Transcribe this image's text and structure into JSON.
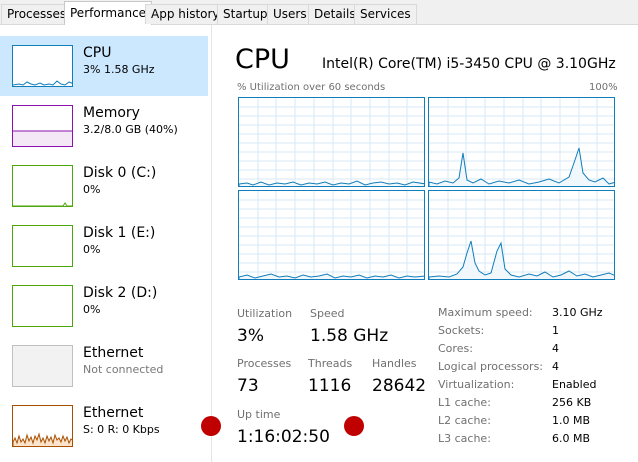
{
  "tabs": [
    {
      "label": "Processes",
      "active": false
    },
    {
      "label": "Performance",
      "active": true
    },
    {
      "label": "App history",
      "active": false
    },
    {
      "label": "Startup",
      "active": false
    },
    {
      "label": "Users",
      "active": false
    },
    {
      "label": "Details",
      "active": false
    },
    {
      "label": "Services",
      "active": false
    }
  ],
  "sidebar": {
    "items": [
      {
        "title": "CPU",
        "subtitle": "3% 1.58 GHz",
        "color": "#117dbb",
        "selected": true
      },
      {
        "title": "Memory",
        "subtitle": "3.2/8.0 GB (40%)",
        "color": "#8b12ae",
        "selected": false
      },
      {
        "title": "Disk 0 (C:)",
        "subtitle": "0%",
        "color": "#4da60c",
        "selected": false
      },
      {
        "title": "Disk 1 (E:)",
        "subtitle": "0%",
        "color": "#4da60c",
        "selected": false
      },
      {
        "title": "Disk 2 (D:)",
        "subtitle": "0%",
        "color": "#4da60c",
        "selected": false
      },
      {
        "title": "Ethernet",
        "subtitle": "Not connected",
        "color": "#c0c0c0",
        "selected": false
      },
      {
        "title": "Ethernet",
        "subtitle": "S: 0 R: 0 Kbps",
        "color": "#a74f01",
        "selected": false
      }
    ]
  },
  "main": {
    "title": "CPU",
    "cpu_name": "Intel(R) Core(TM) i5-3450 CPU @ 3.10GHz",
    "util_label": "% Utilization over 60 seconds",
    "util_max": "100%",
    "graph_color": "#117dbb",
    "stats": {
      "utilization_label": "Utilization",
      "utilization": "3%",
      "speed_label": "Speed",
      "speed": "1.58 GHz",
      "processes_label": "Processes",
      "processes": "73",
      "threads_label": "Threads",
      "threads": "1116",
      "handles_label": "Handles",
      "handles": "28642",
      "uptime_label": "Up time",
      "uptime": "1:16:02:50"
    },
    "specs": [
      {
        "key": "Maximum speed:",
        "value": "3.10 GHz"
      },
      {
        "key": "Sockets:",
        "value": "1"
      },
      {
        "key": "Cores:",
        "value": "4"
      },
      {
        "key": "Logical processors:",
        "value": "4"
      },
      {
        "key": "Virtualization:",
        "value": "Enabled"
      },
      {
        "key": "L1 cache:",
        "value": "256 KB"
      },
      {
        "key": "L2 cache:",
        "value": "1.0 MB"
      },
      {
        "key": "L3 cache:",
        "value": "6.0 MB"
      }
    ]
  },
  "marker_color": "#c00000"
}
